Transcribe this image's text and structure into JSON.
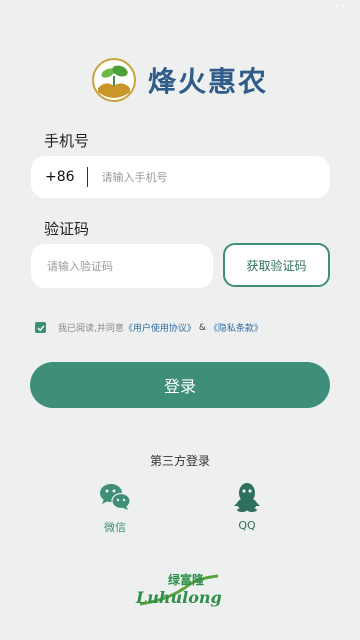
{
  "app": {
    "name": "烽火惠农"
  },
  "form": {
    "phone_label": "手机号",
    "country_code": "+86",
    "phone_placeholder": "请输入手机号",
    "code_label": "验证码",
    "code_placeholder": "请输入验证码",
    "get_code_label": "获取验证码"
  },
  "agreement": {
    "checked": true,
    "text": "我已阅读,并同意",
    "user_agreement": "《用户使用协议》",
    "amp": "&",
    "privacy": "《隐私条款》"
  },
  "login_label": "登录",
  "third_party": {
    "title": "第三方登录",
    "items": [
      {
        "label": "微信",
        "icon": "wechat-icon"
      },
      {
        "label": "QQ",
        "icon": "qq-icon"
      }
    ]
  },
  "brand": {
    "logo_text": "绿富隆"
  },
  "colors": {
    "primary": "#3f8e79",
    "link": "#2e6ca8",
    "background": "#eef0ef",
    "title": "#2f5c8a"
  }
}
